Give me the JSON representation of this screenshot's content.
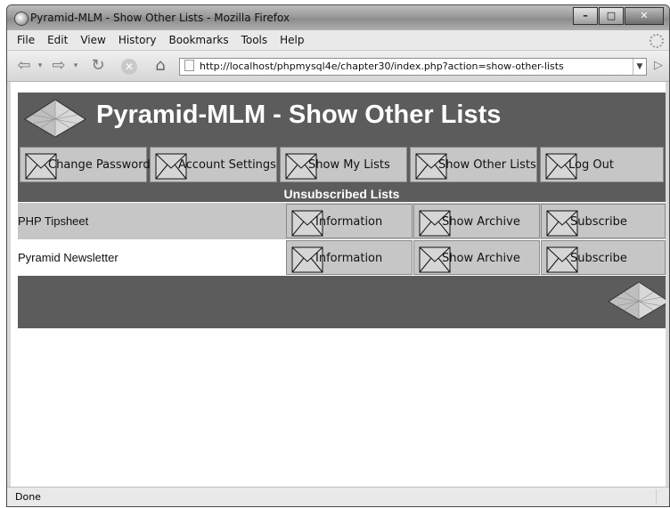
{
  "window": {
    "title": "Pyramid-MLM - Show Other Lists - Mozilla Firefox",
    "controls": {
      "minimize": "–",
      "maximize": "□",
      "close": "✕"
    }
  },
  "menubar": {
    "items": [
      "File",
      "Edit",
      "View",
      "History",
      "Bookmarks",
      "Tools",
      "Help"
    ]
  },
  "toolbar": {
    "url": "http://localhost/phpmysql4e/chapter30/index.php?action=show-other-lists"
  },
  "page": {
    "site_title": "Pyramid-MLM - Show Other Lists",
    "menu": [
      {
        "label": "Change Password"
      },
      {
        "label": "Account Settings"
      },
      {
        "label": "Show My Lists"
      },
      {
        "label": "Show Other Lists"
      },
      {
        "label": "Log Out"
      }
    ],
    "section_heading": "Unsubscribed Lists",
    "lists": [
      {
        "name": "PHP Tipsheet",
        "actions": [
          "Information",
          "Show Archive",
          "Subscribe"
        ]
      },
      {
        "name": "Pyramid Newsletter",
        "actions": [
          "Information",
          "Show Archive",
          "Subscribe"
        ]
      }
    ]
  },
  "status": {
    "text": "Done"
  },
  "colors": {
    "bar": "#5c5c5c",
    "button": "#c6c6c6",
    "row_alt": "#c6c6c6"
  }
}
